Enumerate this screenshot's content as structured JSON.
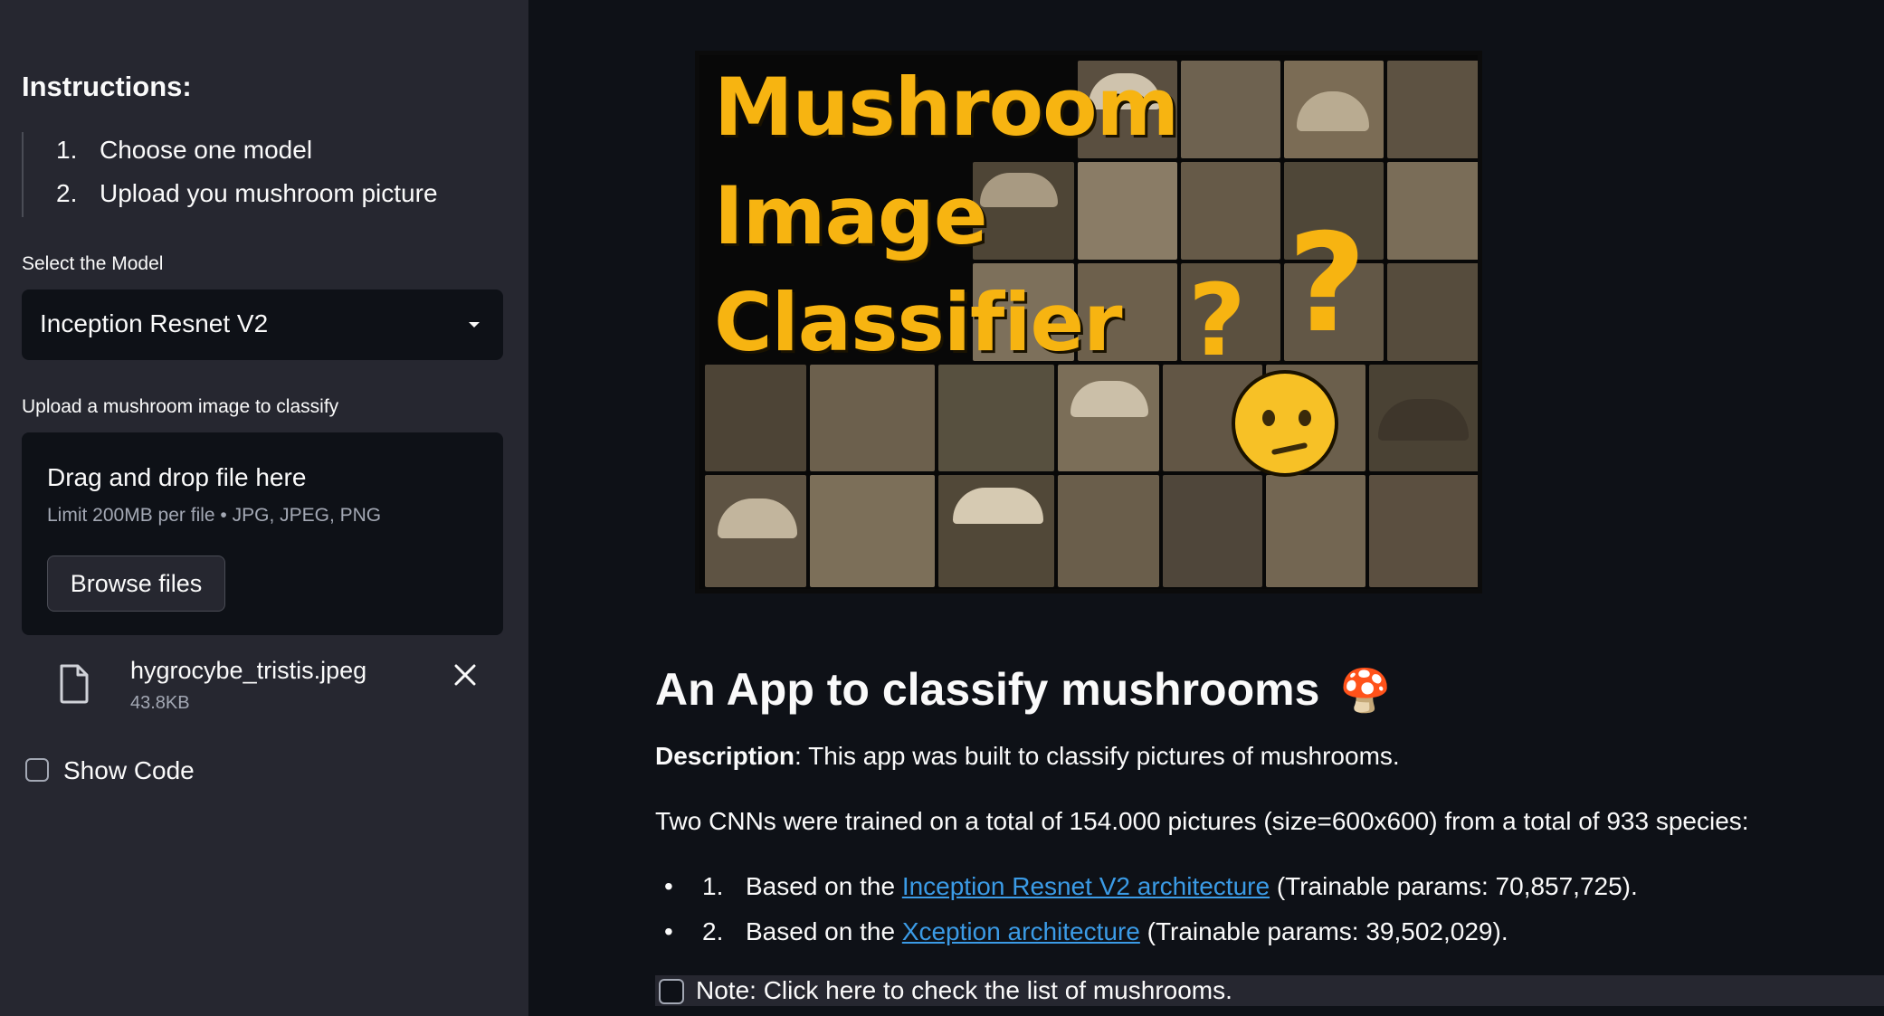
{
  "sidebar": {
    "instructions_title": "Instructions:",
    "steps": [
      {
        "num": "1.",
        "text": "Choose one model"
      },
      {
        "num": "2.",
        "text": "Upload you mushroom picture"
      }
    ],
    "model_label": "Select the Model",
    "model_selected": "Inception Resnet V2",
    "upload_label": "Upload a mushroom image to classify",
    "dropzone": {
      "title": "Drag and drop file here",
      "subtitle": "Limit 200MB per file • JPG, JPEG, PNG",
      "browse_label": "Browse files"
    },
    "uploaded_file": {
      "name": "hygrocybe_tristis.jpeg",
      "size": "43.8KB"
    },
    "show_code_label": "Show Code",
    "show_code_checked": false
  },
  "main": {
    "banner": {
      "line1": "Mushroom",
      "line2": "Image",
      "line3": "Classifier"
    },
    "heading": "An App to classify mushrooms",
    "heading_emoji": "🍄",
    "description_label": "Description",
    "description_text": ": This app was built to classify pictures of mushrooms.",
    "training_text": "Two CNNs were trained on a total of 154.000 pictures (size=600x600) from a total of 933 species:",
    "models": [
      {
        "num": "1.",
        "prefix": "Based on the ",
        "link": "Inception Resnet V2 architecture",
        "suffix": " (Trainable params: 70,857,725)."
      },
      {
        "num": "2.",
        "prefix": "Based on the ",
        "link": "Xception architecture",
        "suffix": " (Trainable params: 39,502,029)."
      }
    ],
    "bullet_symbol": "•",
    "note_label": "Note: Click here to check the list of mushrooms.",
    "note_checked": false
  },
  "colors": {
    "sidebar_bg": "#262730",
    "main_bg": "#0e1117",
    "accent_yellow": "#f7b411",
    "link": "#3b9be6"
  }
}
